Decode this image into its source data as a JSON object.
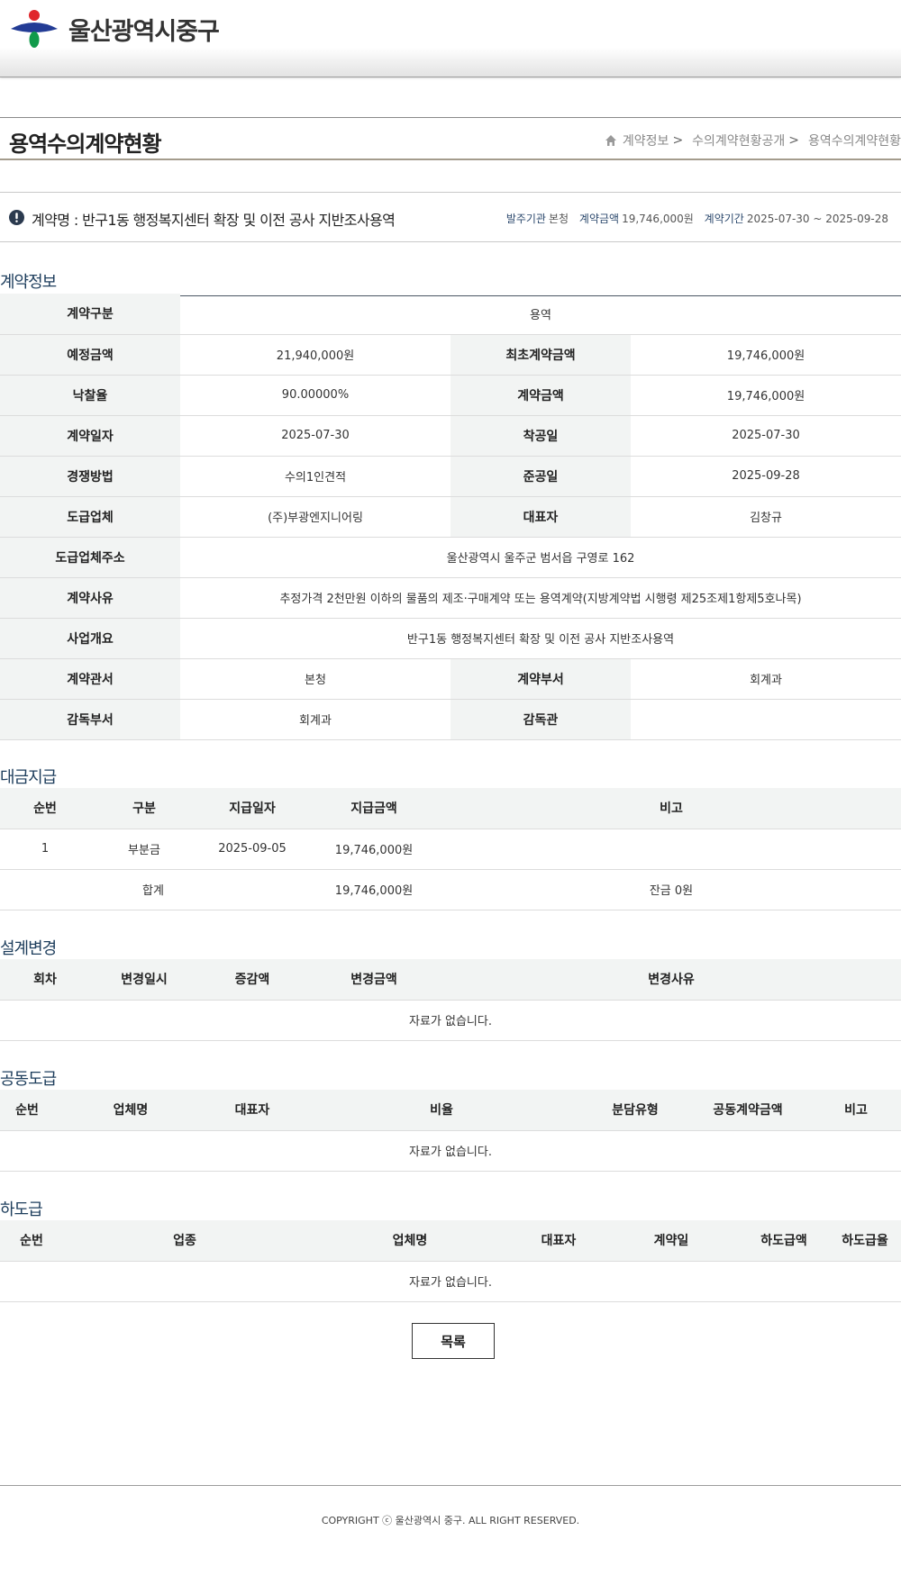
{
  "header": {
    "logo_text": "울산광역시중구"
  },
  "titlebar": {
    "title": "용역수의계약현황",
    "breadcrumb": [
      "계약정보",
      "수의계약현황공개",
      "용역수의계약현황"
    ],
    "sep": ">"
  },
  "summary": {
    "name": "계약명 : 반구1동 행정복지센터 확장 및 이전 공사 지반조사용역",
    "org_label": "발주기관",
    "org_value": "본청",
    "amount_label": "계약금액",
    "amount_value": "19,746,000원",
    "period_label": "계약기간",
    "period_value": "2025-07-30 ~ 2025-09-28"
  },
  "contract_info": {
    "title": "계약정보",
    "type_label": "계약구분",
    "type_value": "용역",
    "est_label": "예정금액",
    "est_value": "21,940,000원",
    "first_label": "최초계약금액",
    "first_value": "19,746,000원",
    "rate_label": "낙찰율",
    "rate_value": "90.00000%",
    "amount_label": "계약금액",
    "amount_value": "19,746,000원",
    "date_label": "계약일자",
    "date_value": "2025-07-30",
    "start_label": "착공일",
    "start_value": "2025-07-30",
    "method_label": "경쟁방법",
    "method_value": "수의1인견적",
    "end_label": "준공일",
    "end_value": "2025-09-28",
    "company_label": "도급업체",
    "company_value": "(주)부광엔지니어링",
    "ceo_label": "대표자",
    "ceo_value": "김창규",
    "addr_label": "도급업체주소",
    "addr_value": "울산광역시 울주군 범서읍 구영로 162",
    "reason_label": "계약사유",
    "reason_value": "추정가격 2천만원 이하의 물품의 제조·구매계약 또는 용역계약(지방계약법 시행령 제25조제1항제5호나목)",
    "summary_label": "사업개요",
    "summary_value": "반구1동 행정복지센터 확장 및 이전 공사 지반조사용역",
    "office_label": "계약관서",
    "office_value": "본청",
    "dept_label": "계약부서",
    "dept_value": "회계과",
    "sup_dept_label": "감독부서",
    "sup_dept_value": "회계과",
    "supervisor_label": "감독관",
    "supervisor_value": ""
  },
  "payment": {
    "title": "대금지급",
    "headers": [
      "순번",
      "구분",
      "지급일자",
      "지급금액",
      "비고"
    ],
    "row": {
      "no": "1",
      "kind": "부분금",
      "date": "2025-09-05",
      "amount": "19,746,000원",
      "note": ""
    },
    "total_label": "합계",
    "total_amount": "19,746,000원",
    "balance": "잔금 0원"
  },
  "design_change": {
    "title": "설계변경",
    "headers": [
      "회차",
      "변경일시",
      "증감액",
      "변경금액",
      "변경사유"
    ],
    "empty": "자료가 없습니다."
  },
  "joint": {
    "title": "공동도급",
    "headers": [
      "순번",
      "업체명",
      "대표자",
      "비율",
      "분담유형",
      "공동계약금액",
      "비고"
    ],
    "empty": "자료가 없습니다."
  },
  "subcontract": {
    "title": "하도급",
    "headers": [
      "순번",
      "업종",
      "업체명",
      "대표자",
      "계약일",
      "하도급액",
      "하도급율"
    ],
    "empty": "자료가 없습니다."
  },
  "list_button": "목록",
  "footer": {
    "copyright": "COPYRIGHT ⓒ 울산광역시 중구. ALL RIGHT RESERVED."
  },
  "colors": {
    "section_title": "#1d3d5c",
    "th_bg": "#f2f4f3",
    "meta_label": "#2d4a6e"
  }
}
